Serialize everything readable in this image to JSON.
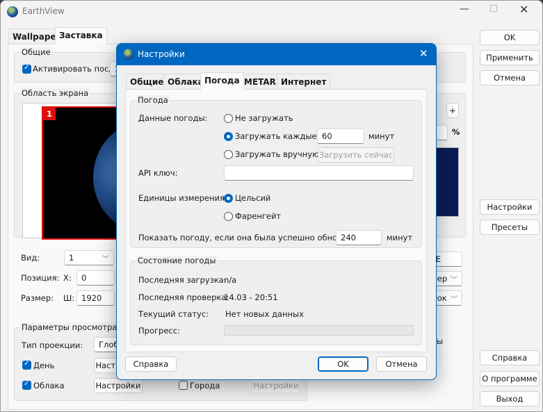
{
  "main": {
    "title": "EarthView",
    "tabs": [
      "Wallpaper",
      "Заставка"
    ],
    "general": {
      "label": "Общие",
      "activate_after": "Активировать после",
      "activate_value": "1"
    },
    "screen_area": {
      "label": "Область экрана",
      "monitor_number": "1"
    },
    "view": {
      "label": "Вид:",
      "value": "1"
    },
    "position": {
      "label": "Позиция:",
      "x_label": "X:",
      "x_value": "0"
    },
    "size": {
      "label": "Размер:",
      "w_label": "Ш:",
      "w_value": "1920"
    },
    "view_params": {
      "label": "Параметры просмотра",
      "projection_label": "Тип проекции:",
      "projection_value": "Глобус",
      "day": "День",
      "day_settings": "Настройки",
      "clouds": "Облака",
      "clouds_settings": "Настройки",
      "cities": "Города",
      "cities_settings": "Настройки"
    },
    "right_partial": {
      "plus": "+",
      "percent": "%",
      "field1": "E",
      "dropdown1": "вер",
      "dropdown2": "ток",
      "text1": "ы"
    },
    "buttons": {
      "ok": "OK",
      "apply": "Применить",
      "cancel": "Отмена",
      "settings": "Настройки",
      "presets": "Пресеты",
      "help": "Справка",
      "about": "О программе",
      "exit": "Выход"
    }
  },
  "dialog": {
    "title": "Настройки",
    "tabs": [
      "Общие",
      "Облака",
      "Погода",
      "METAR",
      "Интернет"
    ],
    "selected_tab": "Погода",
    "weather": {
      "label": "Погода",
      "data_label": "Данные погоды:",
      "opt_none": "Не загружать",
      "opt_every": "Загружать каждые:",
      "every_value": "60",
      "minutes": "минут",
      "opt_manual": "Загружать вручную",
      "load_now": "Загрузить сейчас",
      "api_label": "API ключ:",
      "api_value": "",
      "units_label": "Единицы измерения:",
      "celsius": "Цельсий",
      "fahrenheit": "Фаренгейт",
      "show_label": "Показать погоду, если она была успешно обновлена",
      "show_value": "240",
      "show_minutes": "минут"
    },
    "status": {
      "label": "Состояние погоды",
      "last_load_label": "Последняя загрузка:",
      "last_load": "n/a",
      "last_check_label": "Последняя проверка:",
      "last_check": "14.03 - 20:51",
      "current_label": "Текущий статус:",
      "current": "Нет новых данных",
      "progress_label": "Прогресс:",
      "progress": 0
    },
    "buttons": {
      "help": "Справка",
      "ok": "OK",
      "cancel": "Отмена"
    }
  }
}
